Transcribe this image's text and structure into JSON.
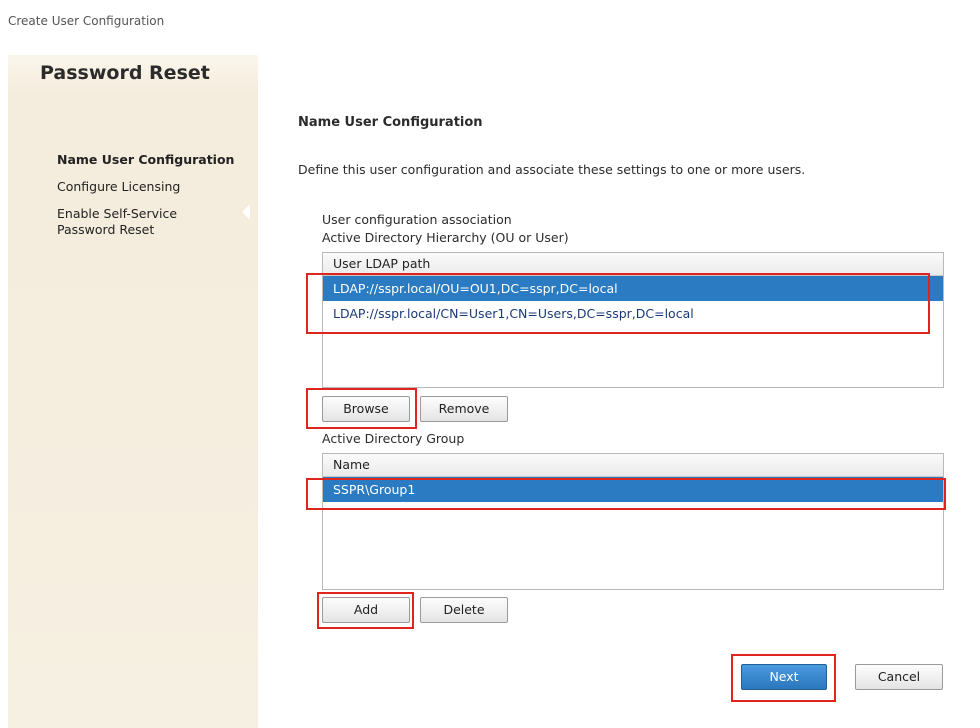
{
  "window": {
    "title": "Create User Configuration"
  },
  "sidebar": {
    "title": "Password Reset",
    "steps": [
      {
        "label": "Name User Configuration",
        "active": true
      },
      {
        "label": "Configure Licensing",
        "active": false
      },
      {
        "label": "Enable Self-Service Password Reset",
        "active": false
      }
    ]
  },
  "main": {
    "section_title": "Name User Configuration",
    "description": "Define this user configuration and associate these settings to one or more users.",
    "association_label": "User configuration association",
    "ad_hierarchy_label": "Active Directory Hierarchy (OU or User)",
    "ldap_list": {
      "header": "User LDAP path",
      "rows": [
        {
          "value": "LDAP://sspr.local/OU=OU1,DC=sspr,DC=local",
          "selected": true
        },
        {
          "value": "LDAP://sspr.local/CN=User1,CN=Users,DC=sspr,DC=local",
          "selected": false
        }
      ]
    },
    "browse_label": "Browse",
    "remove_label": "Remove",
    "ad_group_label": "Active Directory Group",
    "group_list": {
      "header": "Name",
      "rows": [
        {
          "value": "SSPR\\Group1",
          "selected": true
        }
      ]
    },
    "add_label": "Add",
    "delete_label": "Delete"
  },
  "footer": {
    "next_label": "Next",
    "cancel_label": "Cancel"
  },
  "colors": {
    "selection": "#2b7bc2",
    "highlight": "#e0241e",
    "primary_button": "#2b76bd"
  }
}
